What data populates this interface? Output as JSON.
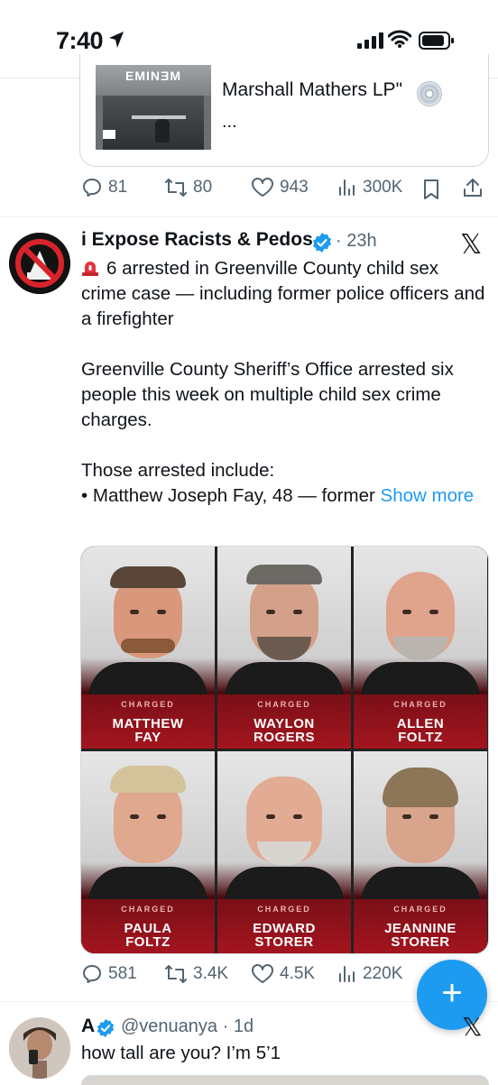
{
  "status_bar": {
    "time": "7:40",
    "icons": [
      "location-arrow-icon",
      "signal-icon",
      "wifi-icon",
      "battery-icon"
    ]
  },
  "previous_tweet": {
    "quote": {
      "album_artist": "EMINƎM",
      "title": "Marshall Mathers LP\"",
      "ellipsis": "..."
    },
    "actions": {
      "replies": "81",
      "reposts": "80",
      "likes": "943",
      "views": "300K"
    }
  },
  "tweet": {
    "display_name": "i Expose Racists & Pedos",
    "time": "23h",
    "body": {
      "headline": "6 arrested in Greenville County child sex crime case — including former police officers and a firefighter",
      "para2": "Greenville County Sheriff’s Office arrested six people this week on multiple child sex crime charges.",
      "para3_line1": "Those arrested include:",
      "para3_line2": "• Matthew Joseph Fay, 48 — former ",
      "show_more": "Show more"
    },
    "mugshots": [
      {
        "label": "CHARGED",
        "name1": "MATTHEW",
        "name2": "FAY"
      },
      {
        "label": "CHARGED",
        "name1": "WAYLON",
        "name2": "ROGERS"
      },
      {
        "label": "CHARGED",
        "name1": "ALLEN",
        "name2": "FOLTZ"
      },
      {
        "label": "CHARGED",
        "name1": "PAULA",
        "name2": "FOLTZ"
      },
      {
        "label": "CHARGED",
        "name1": "EDWARD",
        "name2": "STORER"
      },
      {
        "label": "CHARGED",
        "name1": "JEANNINE",
        "name2": "STORER"
      }
    ],
    "actions": {
      "replies": "581",
      "reposts": "3.4K",
      "likes": "4.5K",
      "views": "220K"
    }
  },
  "reply_tweet": {
    "display_name": "A",
    "handle_time": "@venuanya · 1d",
    "text": "how tall are you? I’m 5’1"
  },
  "fab": {
    "label": "+"
  },
  "colors": {
    "accent": "#1d9bf0",
    "text": "#0f1419",
    "muted": "#536471",
    "banner_red": "#a4151f"
  }
}
